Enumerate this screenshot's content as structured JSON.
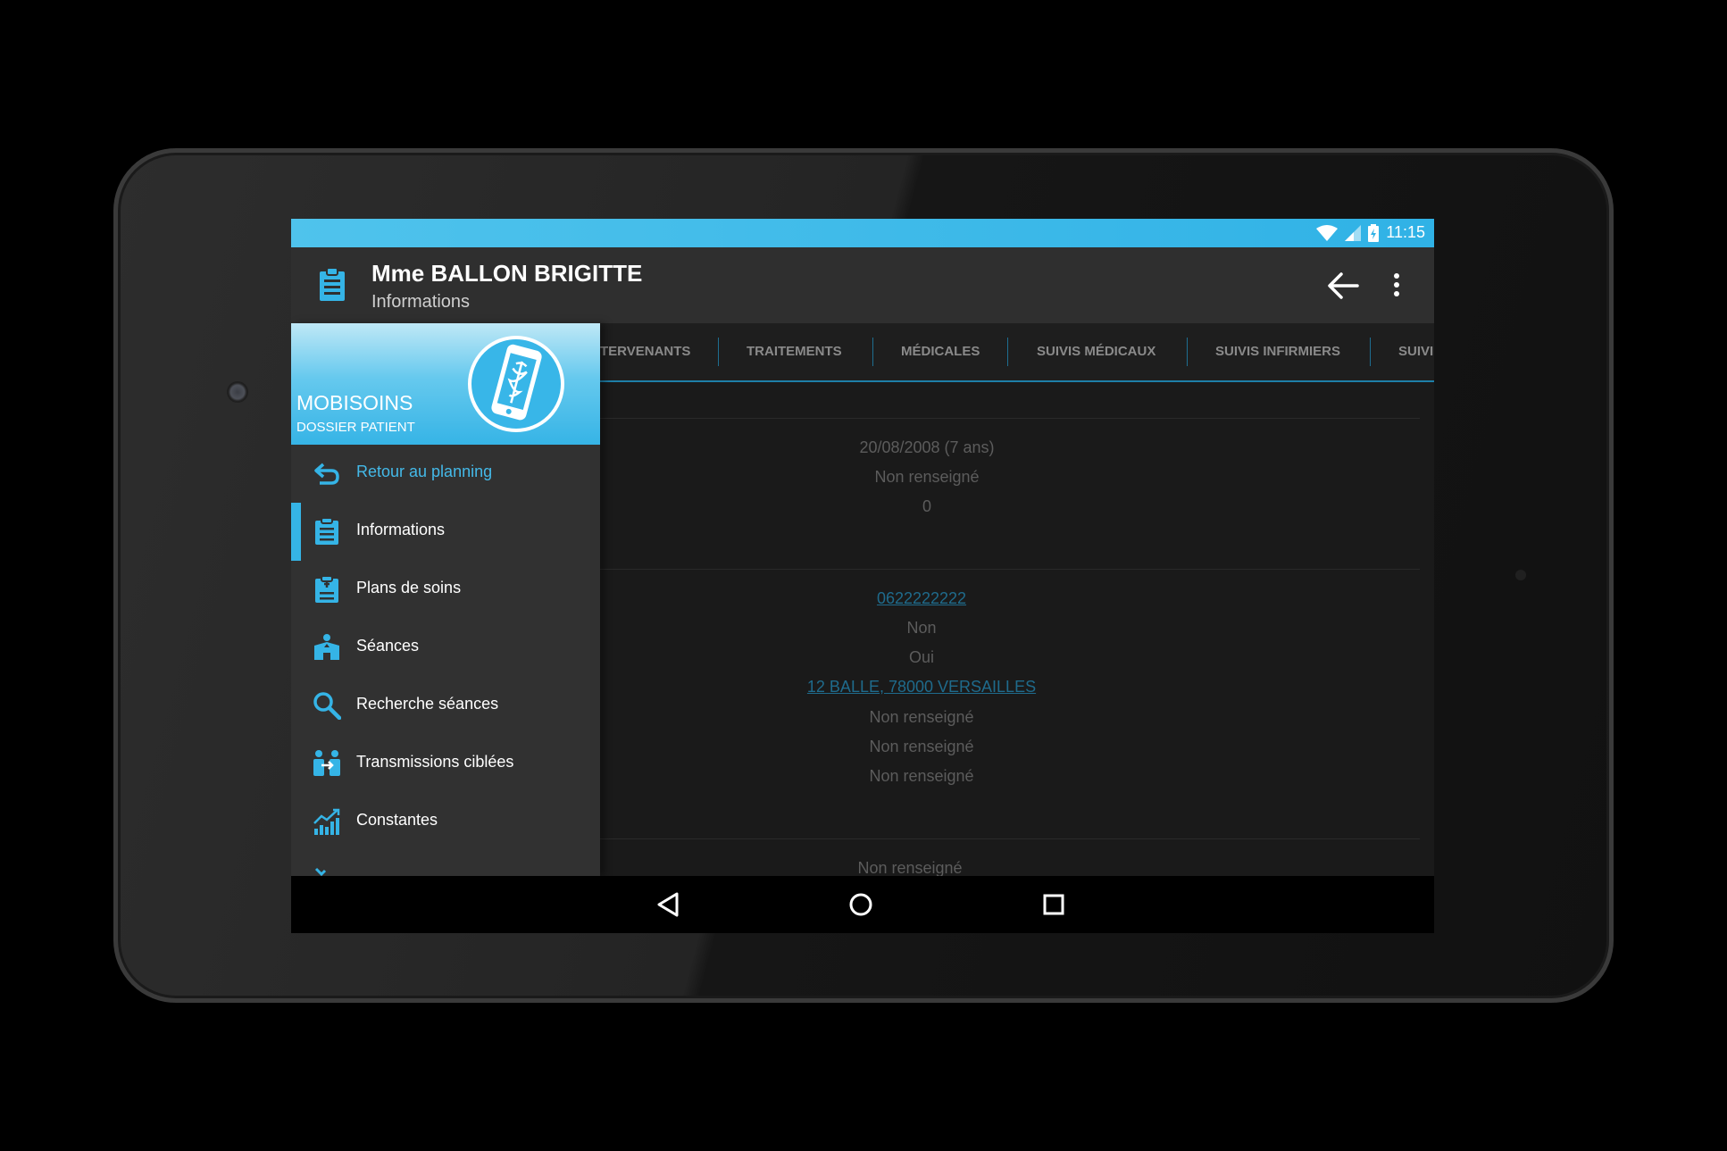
{
  "status": {
    "time": "11:15"
  },
  "actionbar": {
    "title": "Mme BALLON BRIGITTE",
    "subtitle": "Informations"
  },
  "tabs": [
    "TERVENANTS",
    "TRAITEMENTS",
    "MÉDICALES",
    "SUIVIS MÉDICAUX",
    "SUIVIS INFIRMIERS",
    "SUIVI"
  ],
  "content": {
    "section1": [
      "20/08/2008 (7 ans)",
      "Non renseigné",
      "0"
    ],
    "section2": {
      "phone": "0622222222",
      "line2": "Non",
      "line3": "Oui",
      "address": "12 BALLE, 78000 VERSAILLES",
      "line5": "Non renseigné",
      "line6": "Non renseigné",
      "line7": "Non renseigné"
    },
    "section3": [
      "Non renseigné"
    ]
  },
  "drawer": {
    "brand": "MOBISOINS",
    "brand_sub": "DOSSIER PATIENT",
    "items": [
      {
        "label": "Retour au planning",
        "icon": "return-icon"
      },
      {
        "label": "Informations",
        "icon": "clipboard-icon"
      },
      {
        "label": "Plans de soins",
        "icon": "care-plan-icon"
      },
      {
        "label": "Séances",
        "icon": "sessions-icon"
      },
      {
        "label": "Recherche séances",
        "icon": "search-icon"
      },
      {
        "label": "Transmissions ciblées",
        "icon": "transmissions-icon"
      },
      {
        "label": "Constantes",
        "icon": "chart-icon"
      }
    ]
  },
  "colors": {
    "accent": "#35b4e6",
    "statusbar": "#30b2e6",
    "link": "#1f6b8c"
  }
}
